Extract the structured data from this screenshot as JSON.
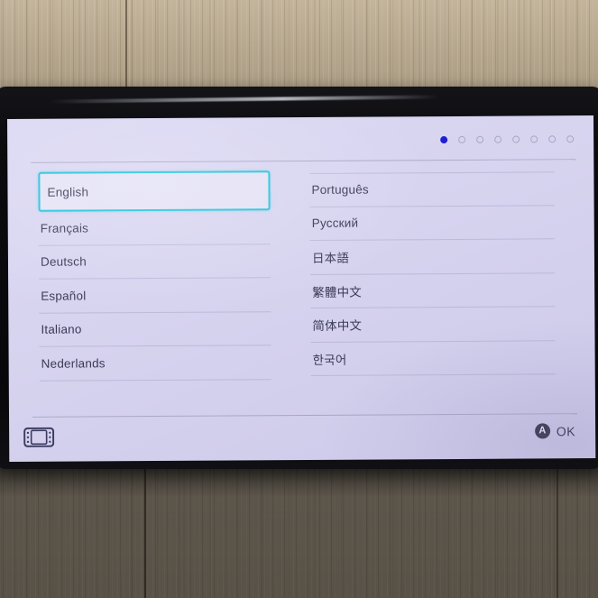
{
  "device": {
    "name": "Nintendo Switch",
    "screen_label": "language-selection-screen"
  },
  "header": {
    "pager": {
      "total_pages": 8,
      "current_page": 1,
      "active_color": "#1e1ed2",
      "inactive_color": "#a9a6c8"
    }
  },
  "selection": {
    "selected_language": "English",
    "highlight_color": "#1fc4dc"
  },
  "languages": {
    "left_column": [
      {
        "label": "English",
        "selected": true
      },
      {
        "label": "Français",
        "selected": false
      },
      {
        "label": "Deutsch",
        "selected": false
      },
      {
        "label": "Español",
        "selected": false
      },
      {
        "label": "Italiano",
        "selected": false
      },
      {
        "label": "Nederlands",
        "selected": false
      }
    ],
    "right_column": [
      {
        "label": "Português",
        "selected": false
      },
      {
        "label": "Русский",
        "selected": false
      },
      {
        "label": "日本語",
        "selected": false
      },
      {
        "label": "繁體中文",
        "selected": false
      },
      {
        "label": "简体中文",
        "selected": false
      },
      {
        "label": "한국어",
        "selected": false
      }
    ]
  },
  "footer": {
    "console_icon": "nintendo-switch-console-icon",
    "confirm_button_glyph": "A",
    "confirm_label": "OK"
  },
  "theme": {
    "screen_background": "#d6d3ef",
    "text_color": "#3a3a55",
    "divider_color": "#9c9ab4",
    "bezel_color": "#0b0b0e"
  }
}
